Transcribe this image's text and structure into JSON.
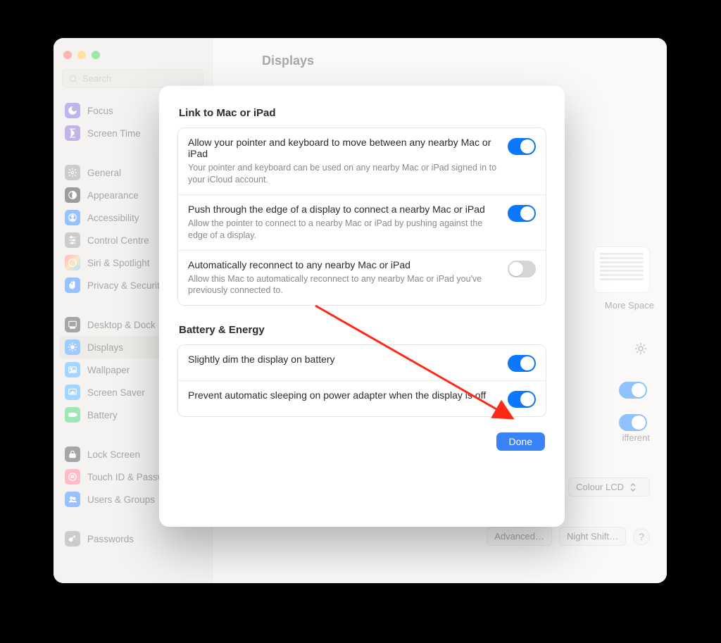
{
  "window": {
    "title": "Displays",
    "search_placeholder": "Search"
  },
  "sidebar": {
    "groups": [
      {
        "items": [
          {
            "label": "Focus",
            "icon": "moon"
          },
          {
            "label": "Screen Time",
            "icon": "hourglass"
          }
        ]
      },
      {
        "items": [
          {
            "label": "General",
            "icon": "gear"
          },
          {
            "label": "Appearance",
            "icon": "contrast"
          },
          {
            "label": "Accessibility",
            "icon": "person"
          },
          {
            "label": "Control Centre",
            "icon": "sliders"
          },
          {
            "label": "Siri & Spotlight",
            "icon": "siri"
          },
          {
            "label": "Privacy & Security",
            "icon": "hand"
          }
        ]
      },
      {
        "items": [
          {
            "label": "Desktop & Dock",
            "icon": "dock"
          },
          {
            "label": "Displays",
            "icon": "sun",
            "selected": true
          },
          {
            "label": "Wallpaper",
            "icon": "photo"
          },
          {
            "label": "Screen Saver",
            "icon": "screensaver"
          },
          {
            "label": "Battery",
            "icon": "battery"
          }
        ]
      },
      {
        "items": [
          {
            "label": "Lock Screen",
            "icon": "lock"
          },
          {
            "label": "Touch ID & Password",
            "icon": "touchid"
          },
          {
            "label": "Users & Groups",
            "icon": "users"
          }
        ]
      },
      {
        "items": [
          {
            "label": "Passwords",
            "icon": "key"
          }
        ]
      }
    ]
  },
  "background_content": {
    "thumb_caption": "More Space",
    "toggle_label_1": "",
    "toggle_label_2": "",
    "right_small_text": "ifferent",
    "color_select": "Colour LCD",
    "advanced_btn": "Advanced…",
    "night_shift_btn": "Night Shift…"
  },
  "sheet": {
    "section1_title": "Link to Mac or iPad",
    "items1": [
      {
        "label": "Allow your pointer and keyboard to move between any nearby Mac or iPad",
        "desc": "Your pointer and keyboard can be used on any nearby Mac or iPad signed in to your iCloud account.",
        "on": true
      },
      {
        "label": "Push through the edge of a display to connect a nearby Mac or iPad",
        "desc": "Allow the pointer to connect to a nearby Mac or iPad by pushing against the edge of a display.",
        "on": true
      },
      {
        "label": "Automatically reconnect to any nearby Mac or iPad",
        "desc": "Allow this Mac to automatically reconnect to any nearby Mac or iPad you've previously connected to.",
        "on": false
      }
    ],
    "section2_title": "Battery & Energy",
    "items2": [
      {
        "label": "Slightly dim the display on battery",
        "desc": "",
        "on": true
      },
      {
        "label": "Prevent automatic sleeping on power adapter when the display is off",
        "desc": "",
        "on": true
      }
    ],
    "done": "Done"
  }
}
